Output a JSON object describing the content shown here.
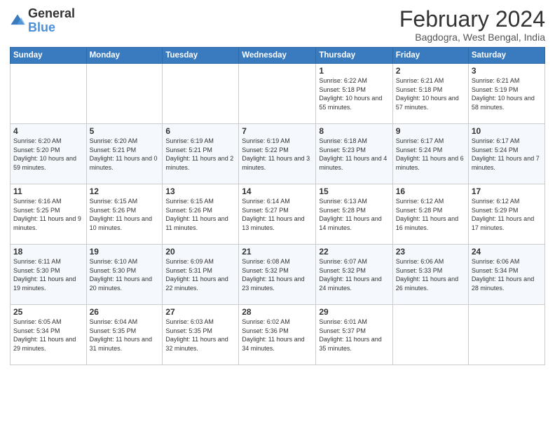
{
  "logo": {
    "general": "General",
    "blue": "Blue"
  },
  "title": "February 2024",
  "subtitle": "Bagdogra, West Bengal, India",
  "days_of_week": [
    "Sunday",
    "Monday",
    "Tuesday",
    "Wednesday",
    "Thursday",
    "Friday",
    "Saturday"
  ],
  "weeks": [
    [
      {
        "day": "",
        "info": ""
      },
      {
        "day": "",
        "info": ""
      },
      {
        "day": "",
        "info": ""
      },
      {
        "day": "",
        "info": ""
      },
      {
        "day": "1",
        "info": "Sunrise: 6:22 AM\nSunset: 5:18 PM\nDaylight: 10 hours and 55 minutes."
      },
      {
        "day": "2",
        "info": "Sunrise: 6:21 AM\nSunset: 5:18 PM\nDaylight: 10 hours and 57 minutes."
      },
      {
        "day": "3",
        "info": "Sunrise: 6:21 AM\nSunset: 5:19 PM\nDaylight: 10 hours and 58 minutes."
      }
    ],
    [
      {
        "day": "4",
        "info": "Sunrise: 6:20 AM\nSunset: 5:20 PM\nDaylight: 10 hours and 59 minutes."
      },
      {
        "day": "5",
        "info": "Sunrise: 6:20 AM\nSunset: 5:21 PM\nDaylight: 11 hours and 0 minutes."
      },
      {
        "day": "6",
        "info": "Sunrise: 6:19 AM\nSunset: 5:21 PM\nDaylight: 11 hours and 2 minutes."
      },
      {
        "day": "7",
        "info": "Sunrise: 6:19 AM\nSunset: 5:22 PM\nDaylight: 11 hours and 3 minutes."
      },
      {
        "day": "8",
        "info": "Sunrise: 6:18 AM\nSunset: 5:23 PM\nDaylight: 11 hours and 4 minutes."
      },
      {
        "day": "9",
        "info": "Sunrise: 6:17 AM\nSunset: 5:24 PM\nDaylight: 11 hours and 6 minutes."
      },
      {
        "day": "10",
        "info": "Sunrise: 6:17 AM\nSunset: 5:24 PM\nDaylight: 11 hours and 7 minutes."
      }
    ],
    [
      {
        "day": "11",
        "info": "Sunrise: 6:16 AM\nSunset: 5:25 PM\nDaylight: 11 hours and 9 minutes."
      },
      {
        "day": "12",
        "info": "Sunrise: 6:15 AM\nSunset: 5:26 PM\nDaylight: 11 hours and 10 minutes."
      },
      {
        "day": "13",
        "info": "Sunrise: 6:15 AM\nSunset: 5:26 PM\nDaylight: 11 hours and 11 minutes."
      },
      {
        "day": "14",
        "info": "Sunrise: 6:14 AM\nSunset: 5:27 PM\nDaylight: 11 hours and 13 minutes."
      },
      {
        "day": "15",
        "info": "Sunrise: 6:13 AM\nSunset: 5:28 PM\nDaylight: 11 hours and 14 minutes."
      },
      {
        "day": "16",
        "info": "Sunrise: 6:12 AM\nSunset: 5:28 PM\nDaylight: 11 hours and 16 minutes."
      },
      {
        "day": "17",
        "info": "Sunrise: 6:12 AM\nSunset: 5:29 PM\nDaylight: 11 hours and 17 minutes."
      }
    ],
    [
      {
        "day": "18",
        "info": "Sunrise: 6:11 AM\nSunset: 5:30 PM\nDaylight: 11 hours and 19 minutes."
      },
      {
        "day": "19",
        "info": "Sunrise: 6:10 AM\nSunset: 5:30 PM\nDaylight: 11 hours and 20 minutes."
      },
      {
        "day": "20",
        "info": "Sunrise: 6:09 AM\nSunset: 5:31 PM\nDaylight: 11 hours and 22 minutes."
      },
      {
        "day": "21",
        "info": "Sunrise: 6:08 AM\nSunset: 5:32 PM\nDaylight: 11 hours and 23 minutes."
      },
      {
        "day": "22",
        "info": "Sunrise: 6:07 AM\nSunset: 5:32 PM\nDaylight: 11 hours and 24 minutes."
      },
      {
        "day": "23",
        "info": "Sunrise: 6:06 AM\nSunset: 5:33 PM\nDaylight: 11 hours and 26 minutes."
      },
      {
        "day": "24",
        "info": "Sunrise: 6:06 AM\nSunset: 5:34 PM\nDaylight: 11 hours and 28 minutes."
      }
    ],
    [
      {
        "day": "25",
        "info": "Sunrise: 6:05 AM\nSunset: 5:34 PM\nDaylight: 11 hours and 29 minutes."
      },
      {
        "day": "26",
        "info": "Sunrise: 6:04 AM\nSunset: 5:35 PM\nDaylight: 11 hours and 31 minutes."
      },
      {
        "day": "27",
        "info": "Sunrise: 6:03 AM\nSunset: 5:35 PM\nDaylight: 11 hours and 32 minutes."
      },
      {
        "day": "28",
        "info": "Sunrise: 6:02 AM\nSunset: 5:36 PM\nDaylight: 11 hours and 34 minutes."
      },
      {
        "day": "29",
        "info": "Sunrise: 6:01 AM\nSunset: 5:37 PM\nDaylight: 11 hours and 35 minutes."
      },
      {
        "day": "",
        "info": ""
      },
      {
        "day": "",
        "info": ""
      }
    ]
  ]
}
